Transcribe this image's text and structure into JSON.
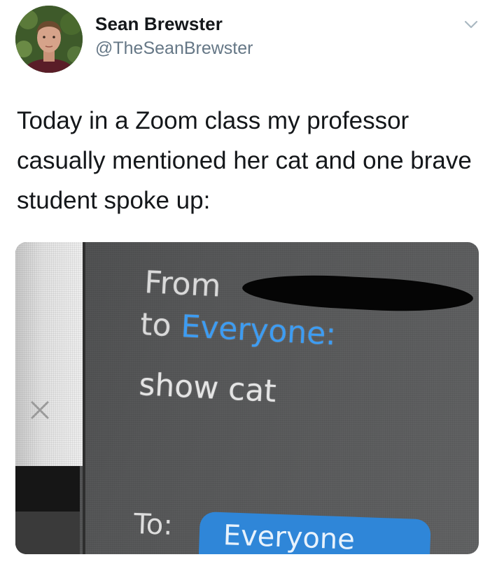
{
  "tweet": {
    "author": {
      "display_name": "Sean Brewster",
      "handle": "@TheSeanBrewster"
    },
    "menu_icon": "chevron-down-icon",
    "text": "Today in a Zoom class my professor casually mentioned her cat and one brave student spoke up:"
  },
  "photo": {
    "chat": {
      "from_label": "From",
      "to_prefix": "to",
      "to_recipient": "Everyone:",
      "message": "show cat",
      "composer_to_label": "To:",
      "composer_recipient": "Everyone"
    },
    "close_icon": "close-icon",
    "colors": {
      "accent_blue": "#3d9cf2",
      "pill_blue": "#2f86d8",
      "chat_background": "#555657"
    }
  }
}
